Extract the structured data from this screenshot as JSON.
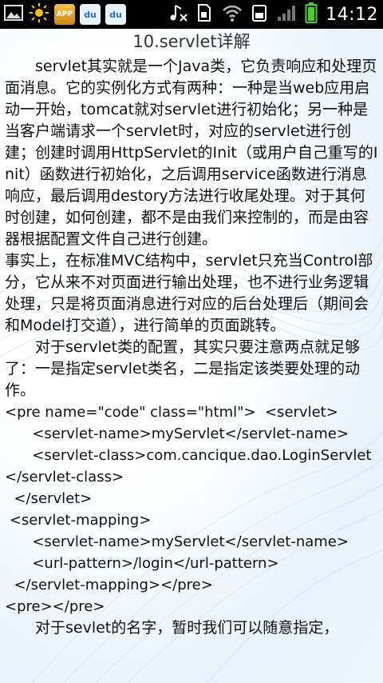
{
  "status_bar": {
    "clock": "14:12",
    "app_badge": "APP",
    "baidu_badge_1": "du",
    "baidu_badge_2": "du"
  },
  "page": {
    "title": "10.servlet详解"
  },
  "article": {
    "para1": "servlet其实就是一个Java类，它负责响应和处理页面消息。它的实例化方式有两种：一种是当web应用启动一开始，tomcat就对servlet进行初始化；另一种是当客户端请求一个servlet时，对应的servlet进行创建；创建时调用HttpServlet的Init（或用户自己重写的Init）函数进行初始化，之后调用service函数进行消息响应，最后调用destory方法进行收尾处理。对于其何时创建，如何创建，都不是由我们来控制的，而是由容器根据配置文件自己进行创建。",
    "para2": "事实上，在标准MVC结构中，servlet只充当Control部分，它从来不对页面进行输出处理，也不进行业务逻辑处理，只是将页面消息进行对应的后台处理后（期间会和Model打交道），进行简单的页面跳转。",
    "para3": "对于servlet类的配置，其实只要注意两点就足够了：一是指定servlet类名，二是指定该类要处理的动作。",
    "code": "<pre name=\"code\" class=\"html\">  <servlet>\n      <servlet-name>myServlet</servlet-name>\n      <servlet-class>com.cancique.dao.LoginServlet</servlet-class>\n  </servlet>\n <servlet-mapping>\n      <servlet-name>myServlet</servlet-name>\n      <url-pattern>/login</url-pattern>\n  </servlet-mapping></pre>\n<pre></pre>",
    "para4": "对于sevlet的名字，暂时我们可以随意指定，"
  }
}
